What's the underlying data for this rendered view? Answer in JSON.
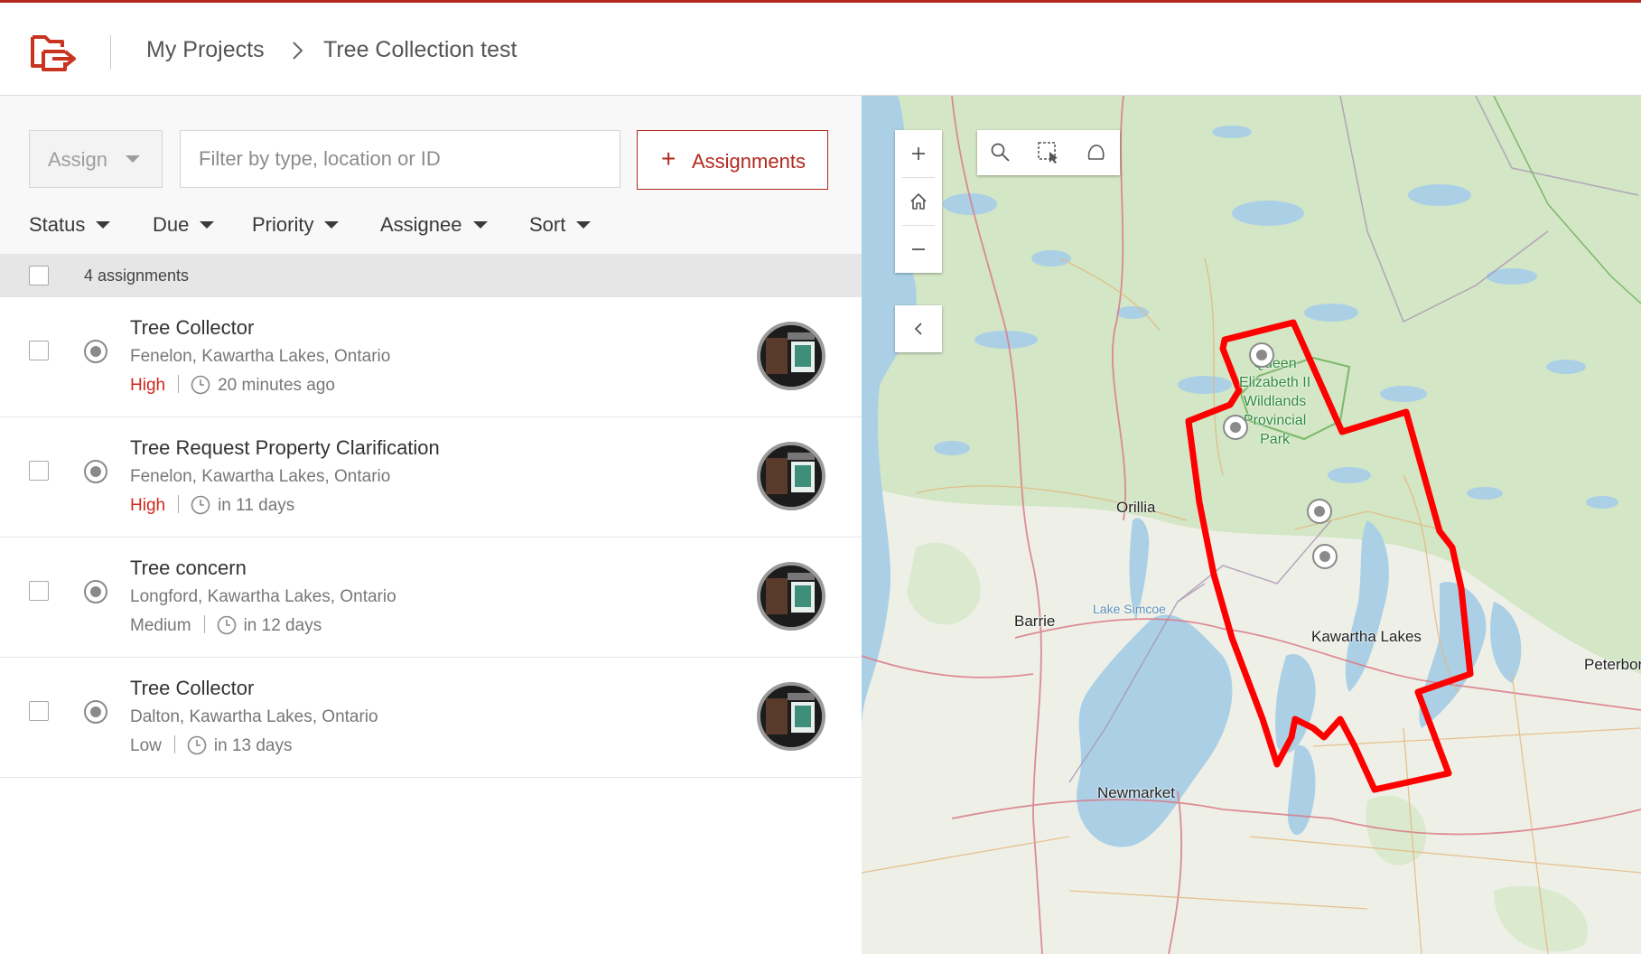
{
  "header": {
    "breadcrumb_root": "My Projects",
    "breadcrumb_current": "Tree Collection test",
    "logo_icon": "folder-arrow-logo-icon"
  },
  "toolbar": {
    "assign_label": "Assign",
    "filter_placeholder": "Filter by type, location or ID",
    "assignments_button": "Assignments",
    "filters": [
      "Status",
      "Due",
      "Priority",
      "Assignee",
      "Sort"
    ],
    "count_label": "4 assignments"
  },
  "assignments": [
    {
      "title": "Tree Collector",
      "location": "Fenelon, Kawartha Lakes, Ontario",
      "priority": "High",
      "due": "20 minutes ago"
    },
    {
      "title": "Tree Request Property Clarification",
      "location": "Fenelon, Kawartha Lakes, Ontario",
      "priority": "High",
      "due": "in 11 days"
    },
    {
      "title": "Tree concern",
      "location": "Longford, Kawartha Lakes, Ontario",
      "priority": "Medium",
      "due": "in 12 days"
    },
    {
      "title": "Tree Collector",
      "location": "Dalton, Kawartha Lakes, Ontario",
      "priority": "Low",
      "due": "in 13 days"
    }
  ],
  "map": {
    "labels": {
      "orillia": "Orillia",
      "barrie": "Barrie",
      "lake_simcoe": "Lake Simcoe",
      "kawartha": "Kawartha Lakes",
      "peterborough": "Peterboro",
      "newmarket": "Newmarket",
      "park_line1": "Queen",
      "park_line2": "Elizabeth II",
      "park_line3": "Wildlands",
      "park_line4": "Provincial",
      "park_line5": "Park"
    },
    "boundary_color": "#ff0000",
    "accent_color": "#b3281e"
  }
}
